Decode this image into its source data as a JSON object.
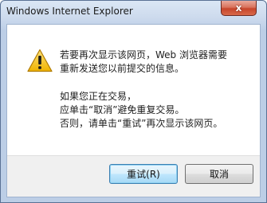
{
  "window": {
    "title": "Windows Internet Explorer",
    "close_glyph": "x",
    "icon": "warning-icon"
  },
  "message": {
    "line1": "若要再次显示该网页，Web 浏览器需要",
    "line2": "重新发送您以前提交的信息。",
    "line3": "如果您正在交易，",
    "line4": "应单击“取消”避免重复交易。",
    "line5": "否则，请单击“重试”再次显示该网页。"
  },
  "buttons": {
    "retry_label": "重试(R)",
    "cancel_label": "取消"
  },
  "colors": {
    "accent": "#3c7fb1",
    "warning": "#f4c430",
    "close": "#c7452b"
  }
}
